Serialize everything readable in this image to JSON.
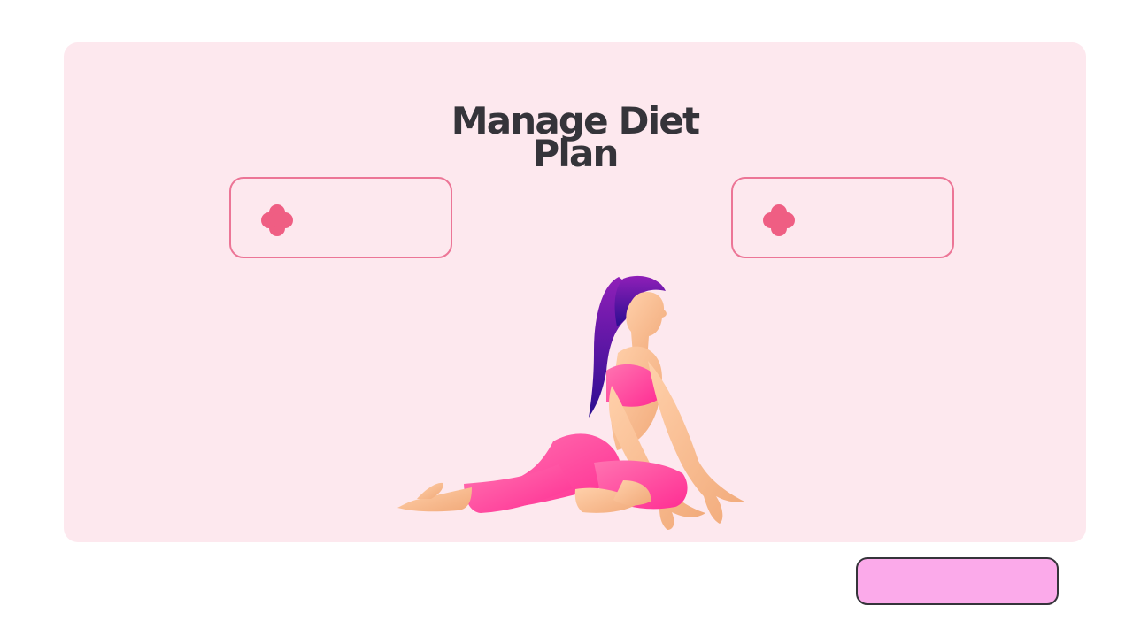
{
  "page": {
    "title_line_1": "Manage Diet",
    "title_line_2": "Plan"
  },
  "options": [
    {
      "label": "",
      "icon": "flower-icon"
    },
    {
      "label": "",
      "icon": "flower-icon"
    }
  ],
  "primary_button": {
    "label": ""
  },
  "colors": {
    "background": "#ffffff",
    "card_background": "#fde8ee",
    "title_text": "#35343a",
    "accent_pink": "#ec7596",
    "button_fill": "#fbaaea",
    "button_border": "#35343a",
    "hair_purple": "#6b16a8",
    "outfit_pink": "#ff4f9a",
    "skin": "#f9c59d"
  },
  "illustration": {
    "name": "woman-yoga-pigeon-pose"
  }
}
